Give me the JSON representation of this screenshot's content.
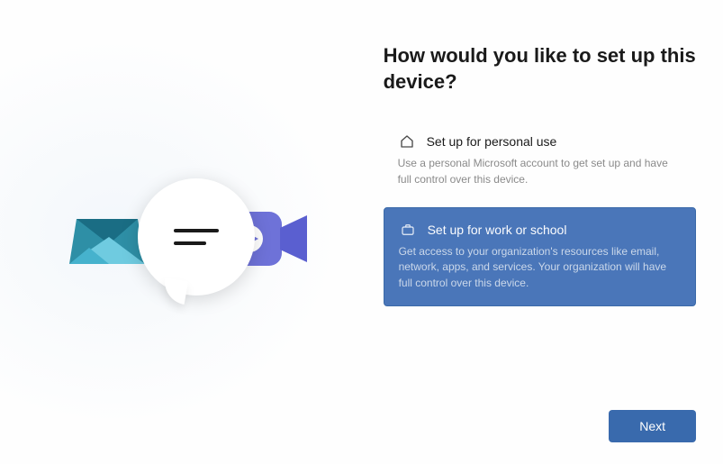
{
  "heading": "How would you like to set up this device?",
  "options": {
    "personal": {
      "title": "Set up for personal use",
      "description": "Use a personal Microsoft account to get set up and have full control over this device.",
      "selected": false
    },
    "work": {
      "title": "Set up for work or school",
      "description": "Get access to your organization's resources like email, network, apps, and services. Your organization will have full control over this device.",
      "selected": true
    }
  },
  "footer": {
    "next_label": "Next"
  },
  "colors": {
    "accent": "#4a76b9",
    "button": "#396aad"
  }
}
